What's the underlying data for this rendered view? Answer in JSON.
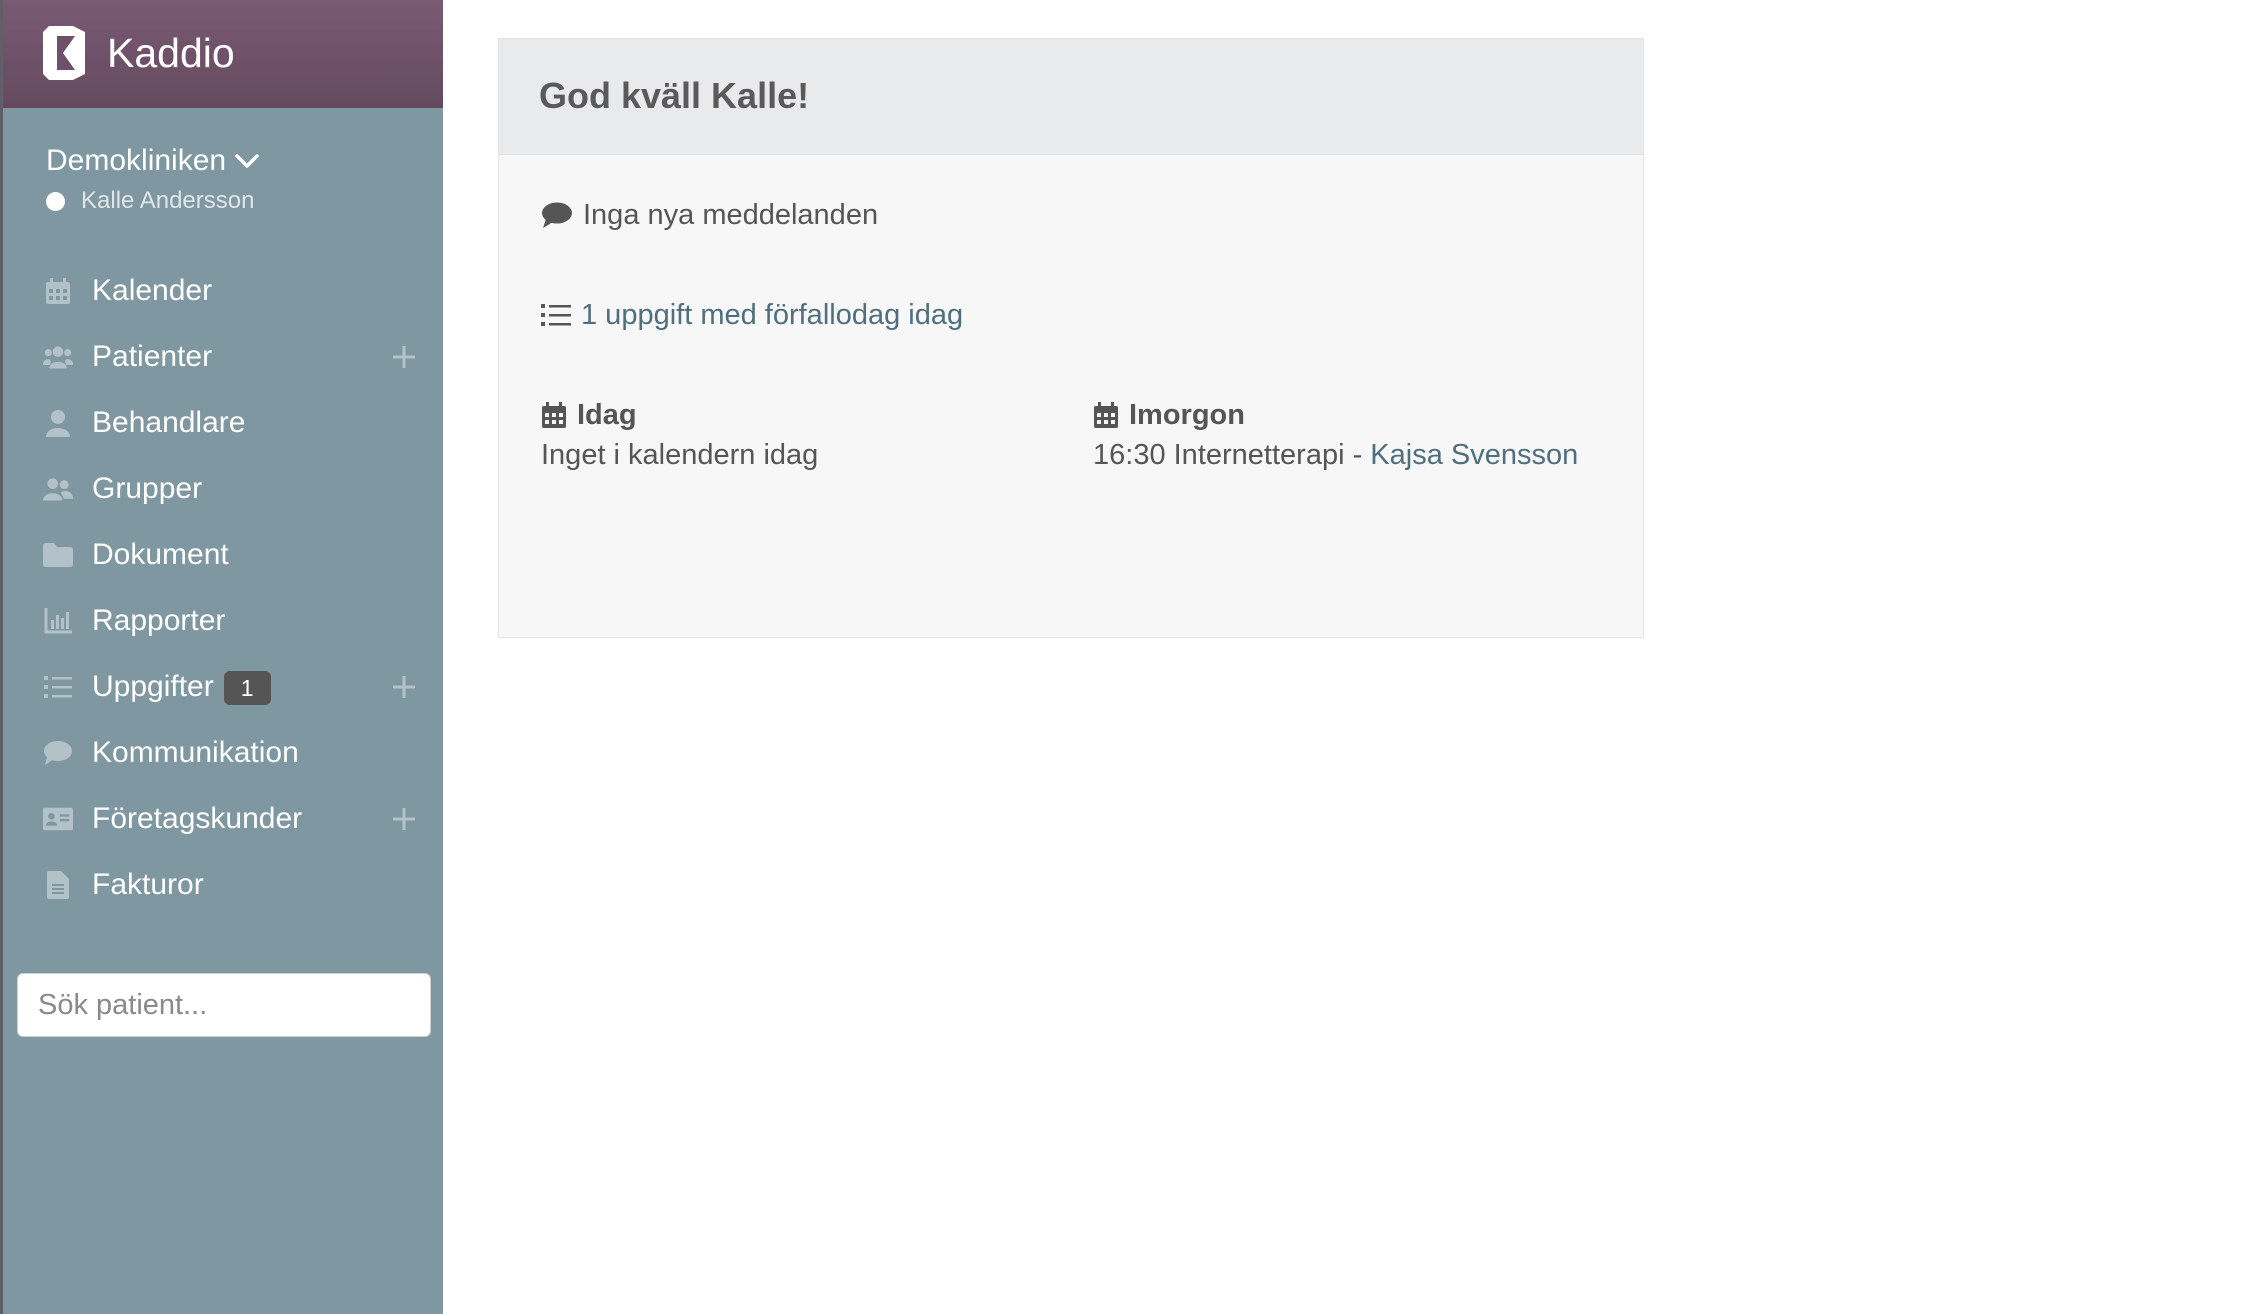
{
  "brand": {
    "name": "Kaddio"
  },
  "sidebar": {
    "clinic": "Demokliniken",
    "user": "Kalle Andersson",
    "items": [
      {
        "label": "Kalender",
        "icon": "calendar-icon"
      },
      {
        "label": "Patienter",
        "icon": "users-icon",
        "add": true
      },
      {
        "label": "Behandlare",
        "icon": "user-icon"
      },
      {
        "label": "Grupper",
        "icon": "users-icon"
      },
      {
        "label": "Dokument",
        "icon": "folder-icon"
      },
      {
        "label": "Rapporter",
        "icon": "chart-icon"
      },
      {
        "label": "Uppgifter",
        "icon": "list-icon",
        "badge": "1",
        "add": true
      },
      {
        "label": "Kommunikation",
        "icon": "comment-icon"
      },
      {
        "label": "Företagskunder",
        "icon": "id-card-icon",
        "add": true
      },
      {
        "label": "Fakturor",
        "icon": "file-icon"
      }
    ],
    "search_placeholder": "Sök patient..."
  },
  "panel": {
    "title": "God kväll Kalle!",
    "messages": "Inga nya meddelanden",
    "tasks_link": "1 uppgift med förfallodag idag",
    "today": {
      "heading": "Idag",
      "text": "Inget i kalendern idag"
    },
    "tomorrow": {
      "heading": "Imorgon",
      "time_text": "16:30 Internetterapi - ",
      "patient_link": "Kajsa Svensson"
    }
  },
  "colors": {
    "sidebar": "#7f97a1",
    "brand_bar": "#6e5068",
    "link": "#4f6f7e",
    "badge": "#555555"
  }
}
